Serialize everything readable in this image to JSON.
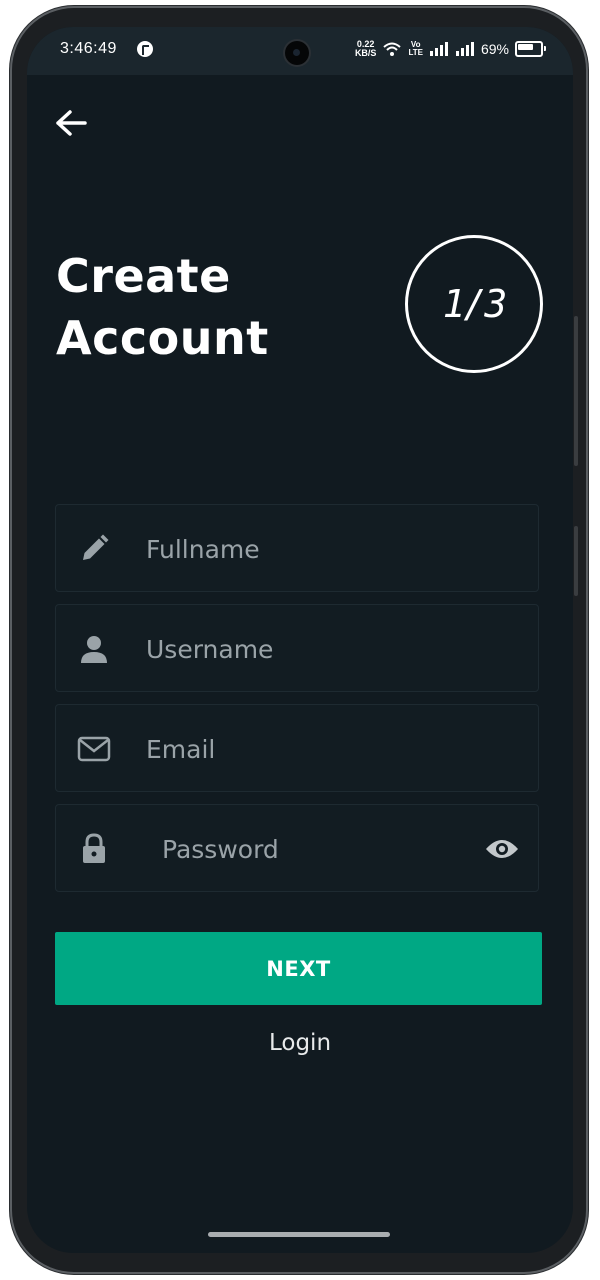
{
  "status_bar": {
    "time": "3:46:49",
    "net_speed_value": "0.22",
    "net_speed_unit": "KB/S",
    "volte_top": "Vo",
    "volte_bottom": "LTE",
    "battery": "69%"
  },
  "header": {
    "back_icon": "arrow-left-icon",
    "title_line1": "Create",
    "title_line2": "Account",
    "step": "1/3"
  },
  "form": {
    "fullname": {
      "placeholder": "Fullname",
      "value": "",
      "icon": "pencil-icon"
    },
    "username": {
      "placeholder": "Username",
      "value": "",
      "icon": "person-icon"
    },
    "email": {
      "placeholder": "Email",
      "value": "",
      "icon": "envelope-icon"
    },
    "password": {
      "placeholder": "Password",
      "value": "",
      "icon": "lock-icon",
      "toggle_icon": "eye-icon"
    }
  },
  "actions": {
    "next_label": "NEXT",
    "login_label": "Login"
  },
  "colors": {
    "background": "#111a20",
    "accent": "#00a884",
    "field_bg": "#121c22",
    "text": "#ffffff",
    "placeholder": "#9aa3a8"
  }
}
